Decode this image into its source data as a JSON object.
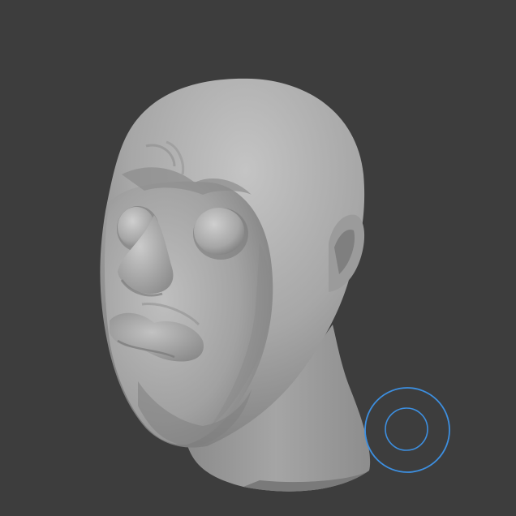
{
  "viewport": {
    "background_color": "#3d3d3d"
  },
  "model": {
    "material_color": "#a8a8a8",
    "shadow_color": "#6f6f6f",
    "highlight_color": "#cfcfcf"
  },
  "brush_cursor": {
    "icon": "brush-cursor-circle-icon",
    "color": "#3d8fe0"
  }
}
